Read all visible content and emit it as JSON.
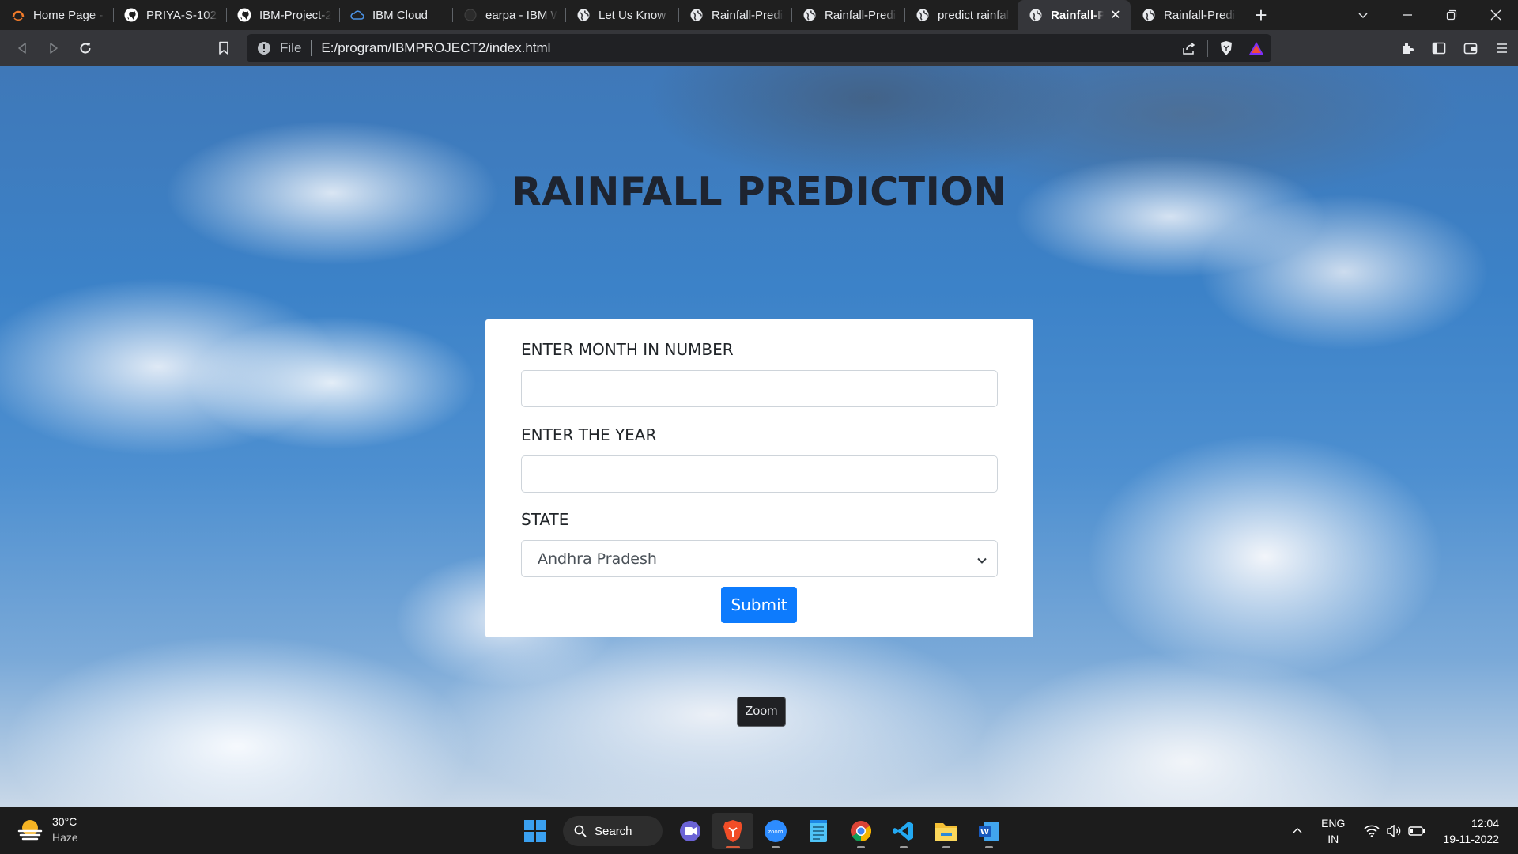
{
  "browser": {
    "tabs": [
      {
        "label": "Home Page - S",
        "icon": "ring-icon",
        "active": false
      },
      {
        "label": "PRIYA-S-102 (F",
        "icon": "github-icon",
        "active": false
      },
      {
        "label": "IBM-Project-24",
        "icon": "github-icon",
        "active": false
      },
      {
        "label": "IBM Cloud",
        "icon": "cloud-icon",
        "active": false
      },
      {
        "label": "earpa - IBM W",
        "icon": "ibm-icon",
        "active": false
      },
      {
        "label": "Let Us Know Yo",
        "icon": "globe-icon",
        "active": false
      },
      {
        "label": "Rainfall-Predict",
        "icon": "globe-icon",
        "active": false
      },
      {
        "label": "Rainfall-Predic",
        "icon": "globe-icon",
        "active": false
      },
      {
        "label": "predict rainfall",
        "icon": "globe-icon",
        "active": false
      },
      {
        "label": "Rainfall-Pr",
        "icon": "globe-icon",
        "active": true
      },
      {
        "label": "Rainfall-Predic",
        "icon": "globe-icon",
        "active": false
      }
    ],
    "close_glyph": "✕",
    "newtab_glyph": "+",
    "address": {
      "scheme_label": "File",
      "url": "E:/program/IBMPROJECT2/index.html"
    }
  },
  "page": {
    "title": "RAINFALL PREDICTION",
    "form": {
      "month_label": "ENTER MONTH IN NUMBER",
      "month_value": "",
      "year_label": "ENTER THE YEAR",
      "year_value": "",
      "state_label": "STATE",
      "state_selected": "Andhra Pradesh",
      "submit_label": "Submit"
    },
    "tooltip": "Zoom"
  },
  "taskbar": {
    "weather_temp": "30°C",
    "weather_condition": "Haze",
    "search_label": "Search",
    "apps": [
      "teams-icon",
      "brave-icon",
      "zoom-icon",
      "notepad-icon",
      "chrome-icon",
      "vscode-icon",
      "file-explorer-icon",
      "word-icon"
    ],
    "lang_top": "ENG",
    "lang_bottom": "IN",
    "time": "12:04",
    "date": "19-11-2022"
  },
  "colors": {
    "submit": "#0d7bfd",
    "tab_strip": "#1f1f1f",
    "toolbar": "#35363a",
    "taskbar": "#1c1c1c"
  }
}
